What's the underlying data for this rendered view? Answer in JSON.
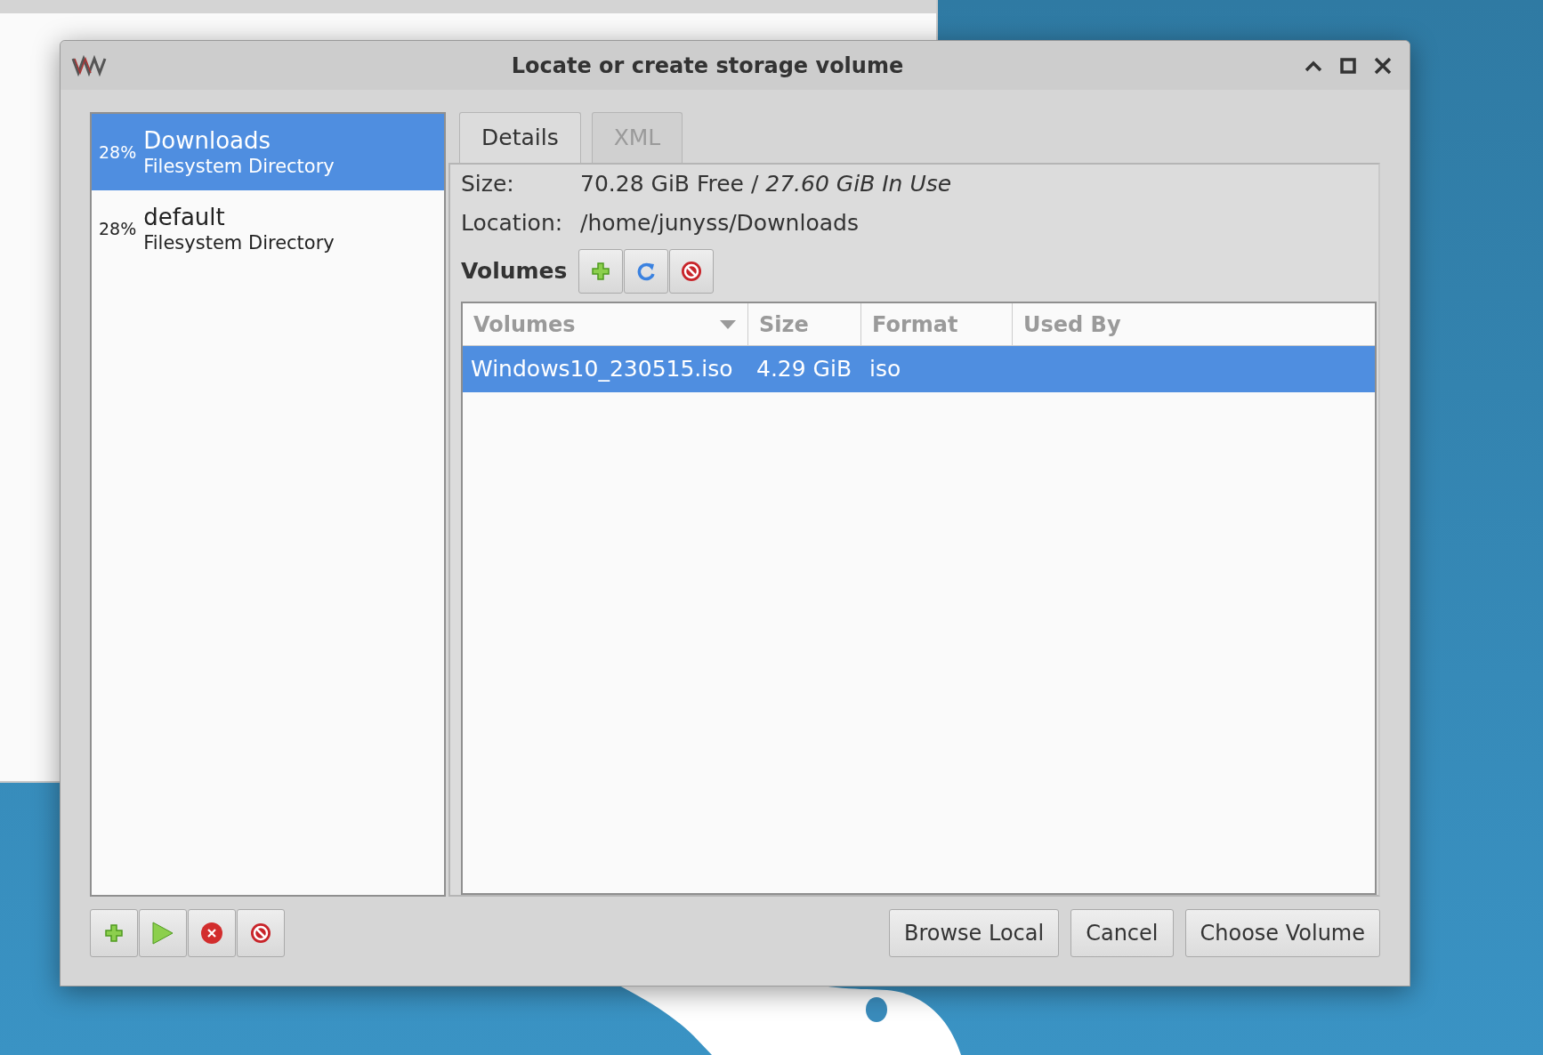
{
  "window": {
    "title": "Locate or create storage volume"
  },
  "pools": [
    {
      "usage": "28%",
      "name": "Downloads",
      "type": "Filesystem Directory",
      "selected": true
    },
    {
      "usage": "28%",
      "name": "default",
      "type": "Filesystem Directory",
      "selected": false
    }
  ],
  "tabs": [
    {
      "label": "Details",
      "selected": true
    },
    {
      "label": "XML",
      "selected": false
    }
  ],
  "details": [
    {
      "label": "Size:",
      "value": "70.28 GiB Free / *27.60 GiB In Use*"
    },
    {
      "label": "Location:",
      "value": "/home/junyss/Downloads"
    }
  ],
  "volumes_label": "Volumes",
  "table": {
    "columns": [
      {
        "label": "Volumes",
        "sorted": true
      },
      {
        "label": "Size",
        "sorted": false
      },
      {
        "label": "Format",
        "sorted": false
      },
      {
        "label": "Used By",
        "sorted": false
      }
    ],
    "rows": [
      {
        "cells": [
          "Windows10_230515.iso",
          "4.29 GiB",
          "iso",
          null
        ],
        "selected": true
      }
    ]
  },
  "buttons": [
    "Browse Local",
    "Cancel",
    "Choose Volume"
  ]
}
